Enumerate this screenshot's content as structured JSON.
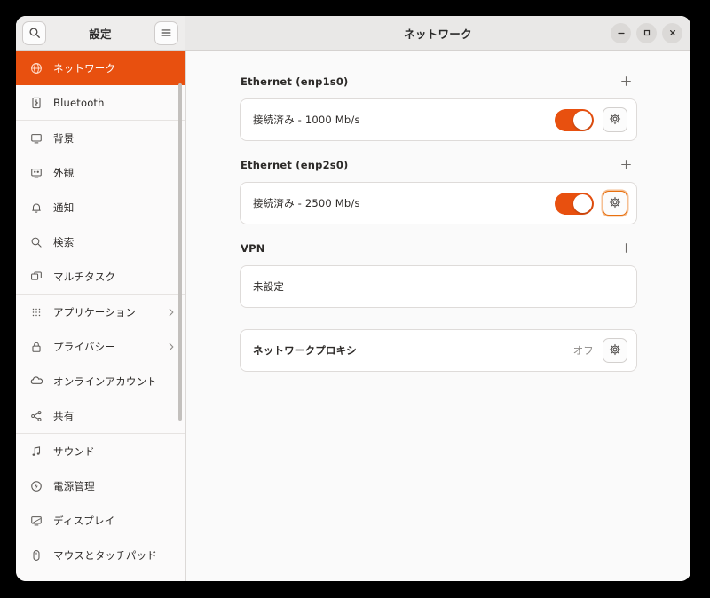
{
  "window": {
    "sidebar_title": "設定",
    "main_title": "ネットワーク",
    "search_icon": "search-icon",
    "menu_icon": "hamburger-menu-icon",
    "controls": {
      "minimize": "minimize-icon",
      "maximize": "maximize-icon",
      "close": "close-icon"
    }
  },
  "accent_color": "#e8500f",
  "sidebar": {
    "groups": [
      {
        "items": [
          {
            "label": "ネットワーク",
            "icon": "globe-icon",
            "selected": true,
            "chevron": false
          },
          {
            "label": "Bluetooth",
            "icon": "bluetooth-icon",
            "selected": false,
            "chevron": false
          }
        ]
      },
      {
        "items": [
          {
            "label": "背景",
            "icon": "wallpaper-icon",
            "selected": false,
            "chevron": false
          },
          {
            "label": "外観",
            "icon": "appearance-icon",
            "selected": false,
            "chevron": false
          },
          {
            "label": "通知",
            "icon": "bell-icon",
            "selected": false,
            "chevron": false
          },
          {
            "label": "検索",
            "icon": "search-icon",
            "selected": false,
            "chevron": false
          },
          {
            "label": "マルチタスク",
            "icon": "multitasking-icon",
            "selected": false,
            "chevron": false
          }
        ]
      },
      {
        "items": [
          {
            "label": "アプリケーション",
            "icon": "grid-apps-icon",
            "selected": false,
            "chevron": true
          },
          {
            "label": "プライバシー",
            "icon": "lock-icon",
            "selected": false,
            "chevron": true
          },
          {
            "label": "オンラインアカウント",
            "icon": "cloud-icon",
            "selected": false,
            "chevron": false
          },
          {
            "label": "共有",
            "icon": "share-icon",
            "selected": false,
            "chevron": false
          }
        ]
      },
      {
        "items": [
          {
            "label": "サウンド",
            "icon": "music-note-icon",
            "selected": false,
            "chevron": false
          },
          {
            "label": "電源管理",
            "icon": "power-icon",
            "selected": false,
            "chevron": false
          },
          {
            "label": "ディスプレイ",
            "icon": "display-icon",
            "selected": false,
            "chevron": false
          },
          {
            "label": "マウスとタッチパッド",
            "icon": "mouse-icon",
            "selected": false,
            "chevron": false
          }
        ]
      }
    ]
  },
  "content": {
    "sections": [
      {
        "title": "Ethernet (enp1s0)",
        "add_icon": "plus-icon",
        "row_label": "接続済み - 1000 Mb/s",
        "toggle_on": true,
        "gear_icon": "gear-icon",
        "gear_focused": false
      },
      {
        "title": "Ethernet (enp2s0)",
        "add_icon": "plus-icon",
        "row_label": "接続済み - 2500 Mb/s",
        "toggle_on": true,
        "gear_icon": "gear-icon",
        "gear_focused": true
      }
    ],
    "vpn": {
      "title": "VPN",
      "add_icon": "plus-icon",
      "row_label": "未設定"
    },
    "proxy": {
      "row_label": "ネットワークプロキシ",
      "value": "オフ",
      "gear_icon": "gear-icon"
    }
  }
}
